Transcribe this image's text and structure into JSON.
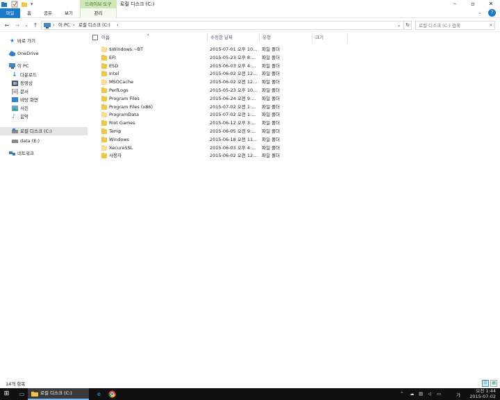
{
  "window": {
    "title": "로컬 디스크 (C:)",
    "context_tab_group": "드라이브 도구"
  },
  "ribbon": {
    "tabs": [
      "파일",
      "홈",
      "공유",
      "보기"
    ],
    "context_tab": "관리"
  },
  "address": {
    "crumbs": [
      "이 PC",
      "로컬 디스크 (C:)"
    ]
  },
  "search": {
    "placeholder": "로컬 디스크 (C:) 검색"
  },
  "nav": {
    "items": [
      {
        "label": "바로 가기",
        "icon": "star-icon"
      },
      {
        "label": "OneDrive",
        "icon": "cloud-icon"
      },
      {
        "label": "이 PC",
        "icon": "computer-icon"
      },
      {
        "label": "다운로드",
        "icon": "download-icon"
      },
      {
        "label": "동영상",
        "icon": "video-icon"
      },
      {
        "label": "문서",
        "icon": "document-icon"
      },
      {
        "label": "바탕 화면",
        "icon": "desktop-icon"
      },
      {
        "label": "사진",
        "icon": "pictures-icon"
      },
      {
        "label": "음악",
        "icon": "music-icon"
      },
      {
        "label": "로컬 디스크 (C:)",
        "icon": "drive-icon"
      },
      {
        "label": "data (E:)",
        "icon": "drive-icon"
      },
      {
        "label": "네트워크",
        "icon": "network-icon"
      }
    ]
  },
  "columns": {
    "name": "이름",
    "modified": "수정한 날짜",
    "type": "유형",
    "size": "크기"
  },
  "files": [
    {
      "name": "$Windows.~BT",
      "modified": "2015-07-01 오후 10...",
      "type": "파일 폴더",
      "hidden": true
    },
    {
      "name": "EFI",
      "modified": "2015-05-23 오후 8:...",
      "type": "파일 폴더",
      "hidden": false
    },
    {
      "name": "ESD",
      "modified": "2015-06-03 오후 4:...",
      "type": "파일 폴더",
      "hidden": false
    },
    {
      "name": "Intel",
      "modified": "2015-06-02 오전 12...",
      "type": "파일 폴더",
      "hidden": false
    },
    {
      "name": "MSOCache",
      "modified": "2015-06-02 오전 12...",
      "type": "파일 폴더",
      "hidden": true
    },
    {
      "name": "PerfLogs",
      "modified": "2015-05-23 오후 10...",
      "type": "파일 폴더",
      "hidden": false
    },
    {
      "name": "Program Files",
      "modified": "2015-06-24 오전 9:...",
      "type": "파일 폴더",
      "hidden": false
    },
    {
      "name": "Program Files (x86)",
      "modified": "2015-07-02 오전 1:...",
      "type": "파일 폴더",
      "hidden": false
    },
    {
      "name": "ProgramData",
      "modified": "2015-07-02 오전 1:...",
      "type": "파일 폴더",
      "hidden": true
    },
    {
      "name": "Riot Games",
      "modified": "2015-06-12 오후 3:...",
      "type": "파일 폴더",
      "hidden": false
    },
    {
      "name": "Temp",
      "modified": "2015-06-05 오전 9:...",
      "type": "파일 폴더",
      "hidden": false
    },
    {
      "name": "Windows",
      "modified": "2015-06-18 오전 11...",
      "type": "파일 폴더",
      "hidden": false
    },
    {
      "name": "XecureSSL",
      "modified": "2015-06-03 오후 4:...",
      "type": "파일 폴더",
      "hidden": true
    },
    {
      "name": "사용자",
      "modified": "2015-06-02 오전 12...",
      "type": "파일 폴더",
      "hidden": false
    }
  ],
  "status": {
    "count": "14개 항목"
  },
  "taskbar": {
    "window_label": "로컬 디스크 (C:)",
    "time": "오전 1:44",
    "date": "2015-07-02",
    "ime": "가"
  }
}
